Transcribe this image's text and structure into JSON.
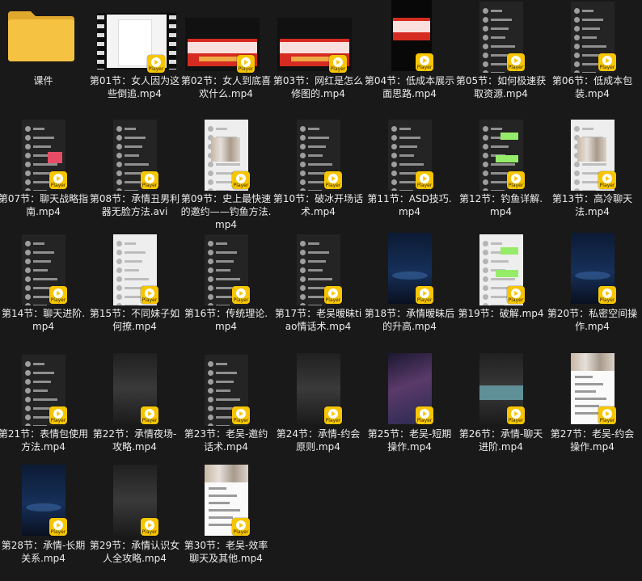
{
  "window": {
    "view": "large-icons",
    "background": "#191919"
  },
  "items": [
    {
      "label": "课件",
      "type": "folder",
      "icon": "folder-icon",
      "thumb": "folder"
    },
    {
      "label": "第01节：女人因为这些倒追.mp4",
      "type": "video",
      "thumb": "film"
    },
    {
      "label": "第02节：女人到底喜欢什么.mp4",
      "type": "video",
      "thumb": "banner"
    },
    {
      "label": "第03节：网红是怎么修图的.mp4",
      "type": "video",
      "thumb": "banner"
    },
    {
      "label": "第04节：低成本展示面思路.mp4",
      "type": "video",
      "thumb": "banner-tall"
    },
    {
      "label": "第05节：如何极速获取资源.mp4",
      "type": "video",
      "thumb": "chat-dark"
    },
    {
      "label": "第06节：低成本包装.mp4",
      "type": "video",
      "thumb": "chat-dark"
    },
    {
      "label": "第07节：聊天战略指南.mp4",
      "type": "video",
      "thumb": "chat-dark-red"
    },
    {
      "label": "第08节：承情丑男利器无脸方法.avi",
      "type": "video",
      "thumb": "chat-dark"
    },
    {
      "label": "第09节：史上最快速的邀约——钓鱼方法.mp4",
      "type": "video",
      "thumb": "chat-light-photo"
    },
    {
      "label": "第10节：破冰开场话术.mp4",
      "type": "video",
      "thumb": "chat-dark"
    },
    {
      "label": "第11节：ASD技巧.mp4",
      "type": "video",
      "thumb": "chat-dark"
    },
    {
      "label": "第12节：钓鱼详解.mp4",
      "type": "video",
      "thumb": "chat-dark-green"
    },
    {
      "label": "第13节：高冷聊天法.mp4",
      "type": "video",
      "thumb": "chat-light-photo"
    },
    {
      "label": "第14节：聊天进阶.mp4",
      "type": "video",
      "thumb": "chat-dark"
    },
    {
      "label": "第15节：不同妹子如何撩.mp4",
      "type": "video",
      "thumb": "chat-light"
    },
    {
      "label": "第16节：传统理论.mp4",
      "type": "video",
      "thumb": "chat-dark"
    },
    {
      "label": "第17节：老吴暧昧tiao情话术.mp4",
      "type": "video",
      "thumb": "chat-dark"
    },
    {
      "label": "第18节：承情暧昧后的升高.mp4",
      "type": "video",
      "thumb": "starfield"
    },
    {
      "label": "第19节：破解.mp4",
      "type": "video",
      "thumb": "chat-light-green"
    },
    {
      "label": "第20节：私密空间操作.mp4",
      "type": "video",
      "thumb": "starfield"
    },
    {
      "label": "第21节：表情包使用方法.mp4",
      "type": "video",
      "thumb": "chat-dark"
    },
    {
      "label": "第22节：承情夜场-攻略.mp4",
      "type": "video",
      "thumb": "gray-video"
    },
    {
      "label": "第23节：老吴-邀约话术.mp4",
      "type": "video",
      "thumb": "chat-dark"
    },
    {
      "label": "第24节：承情-约会原则.mp4",
      "type": "video",
      "thumb": "gray-video"
    },
    {
      "label": "第25节：老吴-短期操作.mp4",
      "type": "video",
      "thumb": "purple-galaxy"
    },
    {
      "label": "第26节：承情-聊天进阶.mp4",
      "type": "video",
      "thumb": "teal-strip"
    },
    {
      "label": "第27节：老吴-约会操作.mp4",
      "type": "video",
      "thumb": "doc-blur"
    },
    {
      "label": "第28节：承情-长期关系.mp4",
      "type": "video",
      "thumb": "starfield"
    },
    {
      "label": "第29节：承情认识女人全攻略.mp4",
      "type": "video",
      "thumb": "gray-video"
    },
    {
      "label": "第30节：老吴-效率聊天及其他.mp4",
      "type": "video",
      "thumb": "doc-blur"
    }
  ],
  "overlay": {
    "label": "Player",
    "icon": "player-badge-icon",
    "color": "#f7c600"
  },
  "colors": {
    "text": "#ececec",
    "folder": "#f5c242",
    "banner": "#d52b20"
  }
}
